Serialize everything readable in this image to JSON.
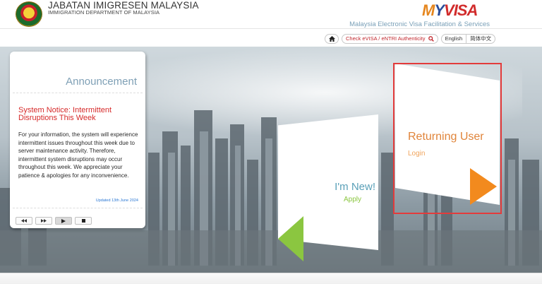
{
  "header": {
    "dept_title": "JABATAN IMIGRESEN MALAYSIA",
    "dept_subtitle": "IMMIGRATION DEPARTMENT OF MALAYSIA",
    "logo_m": "M",
    "logo_y": "Y",
    "logo_v": "VISA",
    "tagline": "Malaysia Electronic Visa Facilitation & Services"
  },
  "topnav": {
    "home_icon": "home-icon",
    "check_label": "Check eVISA / eNTRI Authenticity",
    "search_icon": "search-icon",
    "lang_english": "English",
    "lang_chinese": "简体中文"
  },
  "announcement": {
    "title": "Announcement",
    "headline": "System Notice: Intermittent Disruptions This Week",
    "body": "For your information, the system will experience intermittent issues throughout this week due to server maintenance activity. Therefore, intermittent system disruptions may occur throughout this week. We appreciate your patience & apologies for any inconvenience.",
    "updated": "Updated 13th June 2024",
    "controls": [
      "previous-icon",
      "next-icon",
      "play-icon",
      "stop-icon"
    ]
  },
  "new_user": {
    "title": "I'm New!",
    "action": "Apply",
    "accent": "#8bc640"
  },
  "returning_user": {
    "title": "Returning User",
    "action": "Login",
    "accent": "#f28a1e"
  },
  "colors": {
    "brand_red": "#c1272d",
    "highlight": "#e33b3b"
  }
}
